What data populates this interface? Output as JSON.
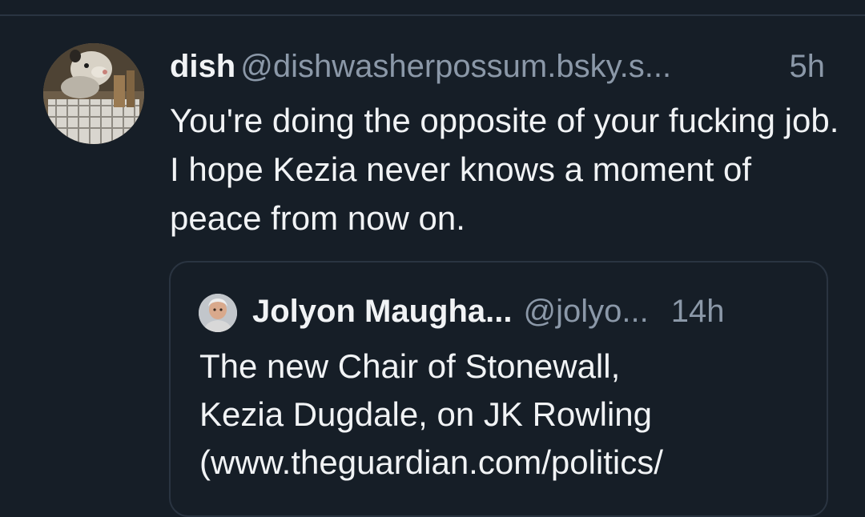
{
  "post": {
    "author_name": "dish",
    "author_handle": "@dishwasherpossum.bsky.s...",
    "time": "5h",
    "text": "You're doing the opposite of your fucking job. I hope Kezia never knows a moment of peace from now on.",
    "avatar_icon": "possum-in-dishwasher-avatar"
  },
  "quote": {
    "author_name": "Jolyon Maugha...",
    "author_handle": "@jolyo...",
    "time": "14h",
    "text": "The new Chair of Stonewall,\nKezia Dugdale, on JK Rowling\n(www.theguardian.com/politics/",
    "avatar_icon": "user-photo-avatar"
  },
  "colors": {
    "background": "#161e27",
    "text": "#f1f3f5",
    "muted": "#8b98a8",
    "border": "#2a3441"
  }
}
